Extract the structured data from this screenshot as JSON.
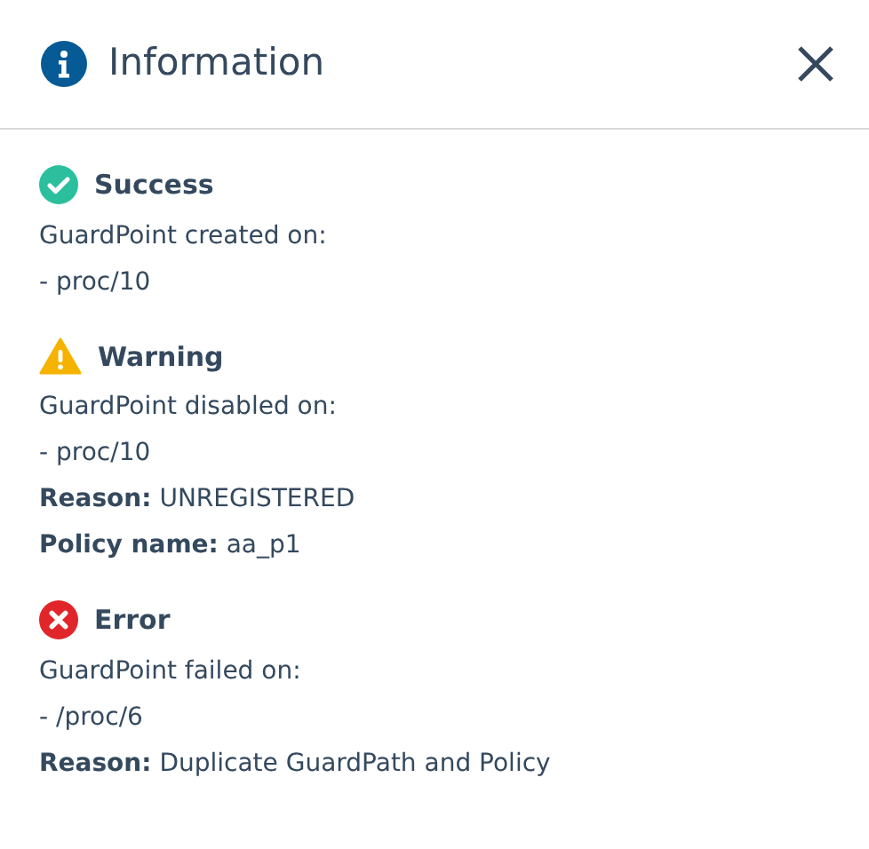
{
  "dialog": {
    "title": "Information"
  },
  "sections": [
    {
      "kind": "success",
      "heading": "Success",
      "lines": [
        "GuardPoint created on:",
        "- proc/10"
      ]
    },
    {
      "kind": "warning",
      "heading": "Warning",
      "lines": [
        "GuardPoint disabled on:",
        "- proc/10",
        "**Reason:** UNREGISTERED",
        "**Policy name:** aa_p1"
      ]
    },
    {
      "kind": "error",
      "heading": "Error",
      "lines": [
        "GuardPoint failed on:",
        "- /proc/6",
        "**Reason:** Duplicate GuardPath and Policy"
      ]
    }
  ]
}
